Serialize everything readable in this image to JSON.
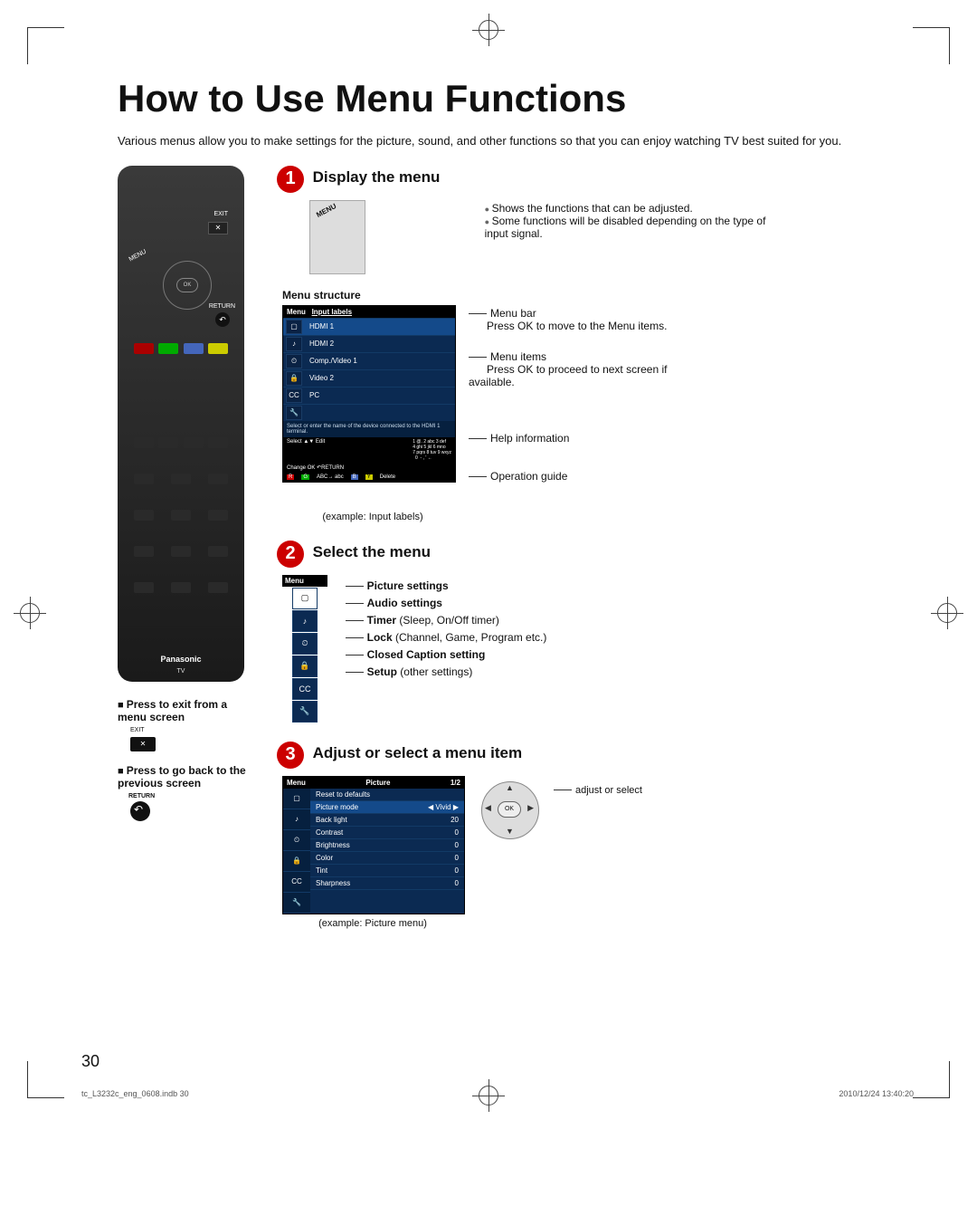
{
  "page_title": "How to Use Menu Functions",
  "intro": "Various menus allow you to make settings for the picture, sound, and other functions so that you can enjoy watching TV best suited for you.",
  "remote": {
    "exit_label": "EXIT",
    "ok_label": "OK",
    "return_label": "RETURN",
    "menu_label": "MENU",
    "brand": "Panasonic",
    "tv": "TV"
  },
  "below_remote": {
    "exit_hdr": "Press to exit from a menu screen",
    "exit_key_small": "EXIT",
    "back_hdr": "Press to go back to the previous screen",
    "return_small": "RETURN"
  },
  "step1": {
    "num": "1",
    "title": "Display the menu",
    "bullets": [
      "Shows the functions that can be adjusted.",
      "Some functions will be disabled depending on the type of input signal."
    ],
    "sub": "Menu structure",
    "osd": {
      "bar_left": "Menu",
      "bar_right": "Input labels",
      "items": [
        "HDMI 1",
        "HDMI 2",
        "Comp./Video 1",
        "Video 2",
        "PC"
      ],
      "help": "Select or enter the name of the device connected to the HDMI 1 terminal.",
      "guide_select": "Select",
      "guide_edit": "Edit",
      "guide_change": "Change",
      "guide_return": "RETURN",
      "footer_r": "R",
      "footer_abc": "ABC→ abc",
      "footer_b": "B",
      "footer_y": "Y",
      "footer_delete": "Delete",
      "keypad": "1 @. 2 abc 3 def\n4 ghi 5 jkl 6 mno\n7 pqrs 8 tuv 9 wxyz\n  0  - , ' ←"
    },
    "labels": {
      "menubar": "Menu bar",
      "menubar_desc": "Press OK to move to the Menu items.",
      "menuitems": "Menu items",
      "menuitems_desc": "Press OK to proceed to next screen if available.",
      "help": "Help information",
      "opguide": "Operation guide"
    },
    "example": "(example: Input labels)"
  },
  "step2": {
    "num": "2",
    "title": "Select the menu",
    "osd_bar": "Menu",
    "items": [
      {
        "label": "Picture settings",
        "desc": ""
      },
      {
        "label": "Audio settings",
        "desc": ""
      },
      {
        "label": "Timer",
        "desc": " (Sleep, On/Off timer)"
      },
      {
        "label": "Lock",
        "desc": " (Channel, Game, Program etc.)"
      },
      {
        "label": "Closed Caption setting",
        "desc": ""
      },
      {
        "label": "Setup",
        "desc": " (other settings)"
      }
    ],
    "icons": [
      "▢",
      "♪",
      "⏲",
      "🔒",
      "CC",
      "🔧"
    ]
  },
  "step3": {
    "num": "3",
    "title": "Adjust or select a menu item",
    "osd": {
      "bar_left": "Menu",
      "bar_mid": "Picture",
      "bar_right": "1/2",
      "rows": [
        {
          "l": "Reset to defaults",
          "v": ""
        },
        {
          "l": "Picture mode",
          "v": "Vivid"
        },
        {
          "l": "Back light",
          "v": "20"
        },
        {
          "l": "Contrast",
          "v": "0"
        },
        {
          "l": "Brightness",
          "v": "0"
        },
        {
          "l": "Color",
          "v": "0"
        },
        {
          "l": "Tint",
          "v": "0"
        },
        {
          "l": "Sharpness",
          "v": "0"
        }
      ]
    },
    "dpad_ok": "OK",
    "adjust_label": "adjust or select",
    "example": "(example: Picture menu)"
  },
  "page_number": "30",
  "footer": {
    "file": "tc_L3232c_eng_0608.indb   30",
    "timestamp": "2010/12/24   13:40:20"
  }
}
